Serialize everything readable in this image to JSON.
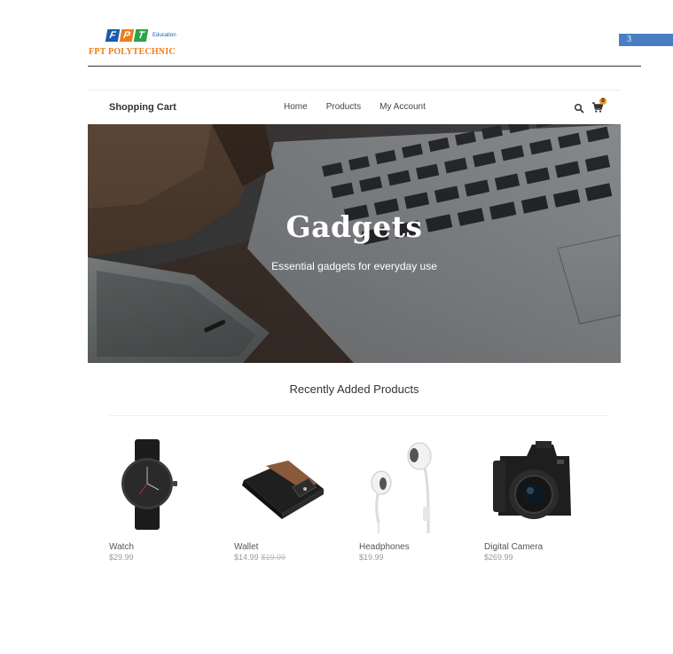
{
  "doc": {
    "logo_letters": [
      "F",
      "P",
      "T"
    ],
    "logo_edu": "Education",
    "logo_name": "FPT POLYTECHNIC",
    "page_number": "3"
  },
  "site": {
    "brand": "Shopping Cart",
    "nav": [
      "Home",
      "Products",
      "My Account"
    ],
    "cart_count": "0",
    "hero": {
      "title": "Gadgets",
      "subtitle": "Essential gadgets for everyday use"
    },
    "section_title": "Recently Added Products",
    "products": [
      {
        "name": "Watch",
        "price": "$29.99",
        "old_price": ""
      },
      {
        "name": "Wallet",
        "price": "$14.99",
        "old_price": "$19.99"
      },
      {
        "name": "Headphones",
        "price": "$19.99",
        "old_price": ""
      },
      {
        "name": "Digital Camera",
        "price": "$269.99",
        "old_price": ""
      }
    ]
  },
  "icons": {
    "search": "search-icon",
    "cart": "cart-icon"
  },
  "colors": {
    "accent": "#e8962f",
    "page_box": "#4a7ec2",
    "fpt_blue": "#1a5cad",
    "fpt_orange": "#ef7d1a",
    "fpt_green": "#2aa34a"
  }
}
